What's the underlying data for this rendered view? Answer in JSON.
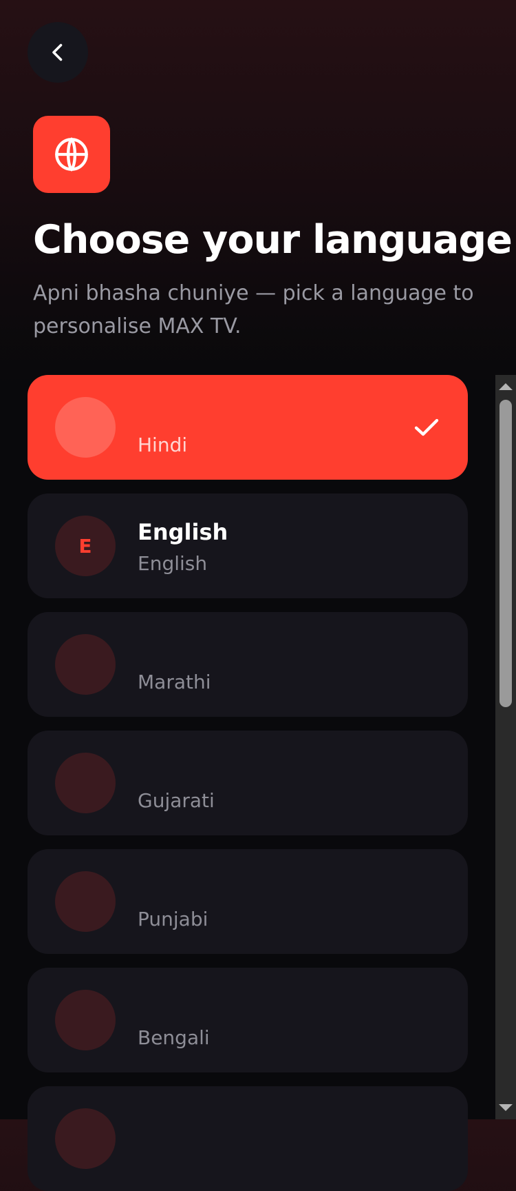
{
  "header": {
    "title": "Choose your language",
    "subtitle": "Apni bhasha chuniye — pick a language to personalise MAX TV."
  },
  "languages": [
    {
      "name": "",
      "sub": "Hindi",
      "avatar": "",
      "selected": true
    },
    {
      "name": "English",
      "sub": "English",
      "avatar": "E",
      "selected": false
    },
    {
      "name": "",
      "sub": "Marathi",
      "avatar": "",
      "selected": false
    },
    {
      "name": "",
      "sub": "Gujarati",
      "avatar": "",
      "selected": false
    },
    {
      "name": "",
      "sub": "Punjabi",
      "avatar": "",
      "selected": false
    },
    {
      "name": "",
      "sub": "Bengali",
      "avatar": "",
      "selected": false
    },
    {
      "name": "",
      "sub": "",
      "avatar": "",
      "selected": false
    }
  ],
  "icons": {
    "back": "chevron-left-icon",
    "badge": "globe-icon",
    "selected": "check-icon"
  },
  "colors": {
    "accent": "#ff3e2f",
    "card": "#16151c",
    "avatar": "#3a1a1f",
    "muted_text": "#8e8e97"
  }
}
